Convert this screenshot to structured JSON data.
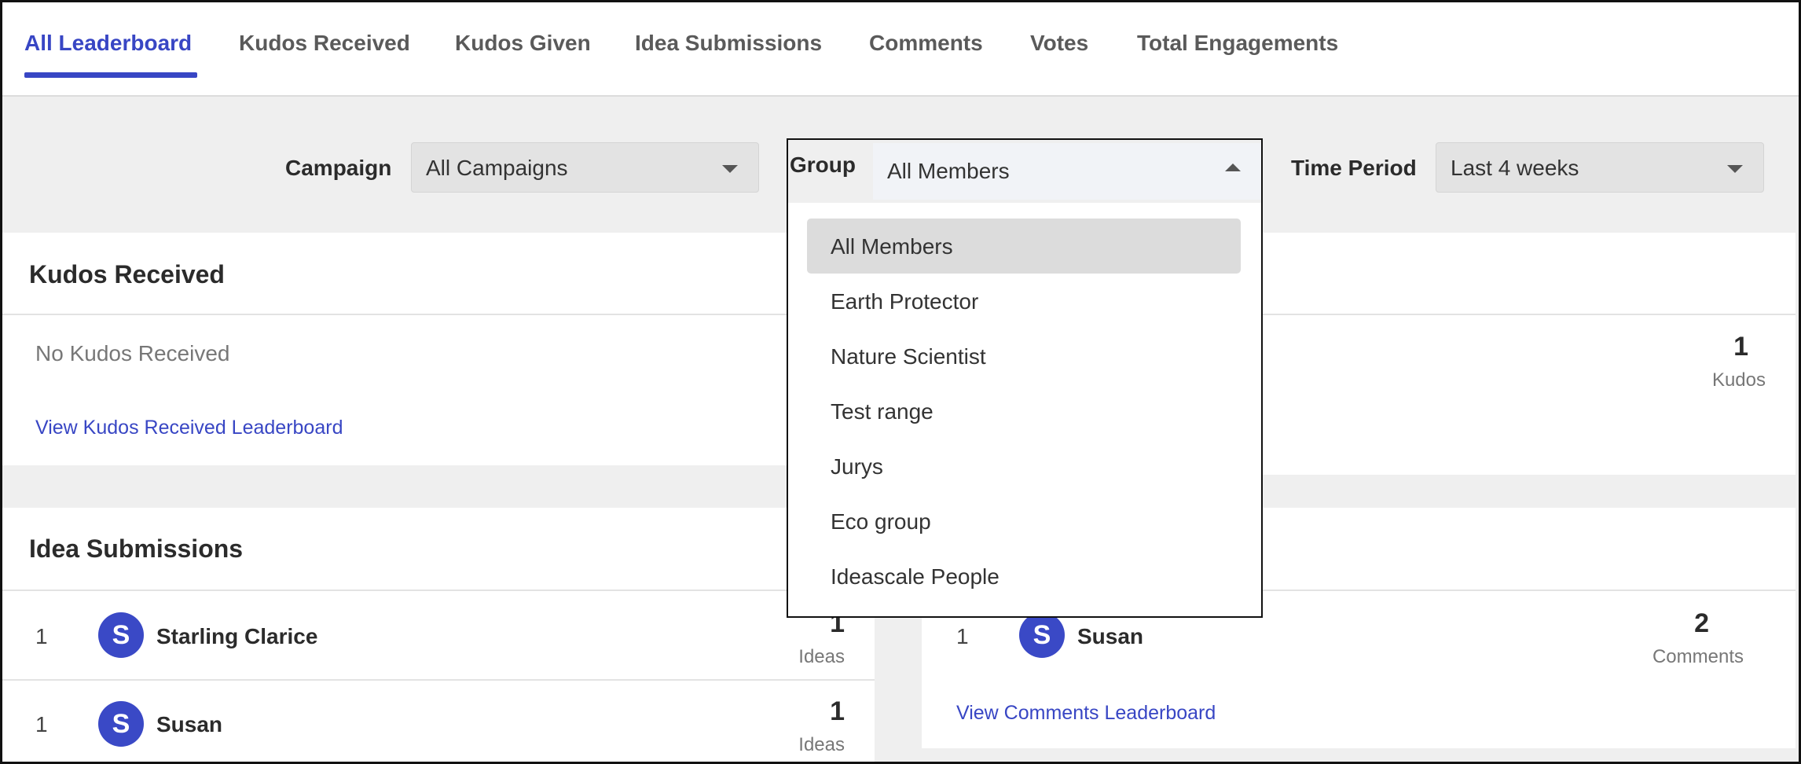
{
  "tabs": [
    {
      "label": "All Leaderboard",
      "active": true
    },
    {
      "label": "Kudos Received",
      "active": false
    },
    {
      "label": "Kudos Given",
      "active": false
    },
    {
      "label": "Idea Submissions",
      "active": false
    },
    {
      "label": "Comments",
      "active": false
    },
    {
      "label": "Votes",
      "active": false
    },
    {
      "label": "Total Engagements",
      "active": false
    }
  ],
  "filters": {
    "campaign": {
      "label": "Campaign",
      "value": "All Campaigns"
    },
    "group": {
      "label": "Group",
      "value": "All Members",
      "options": [
        "All Members",
        "Earth Protector",
        "Nature Scientist",
        "Test range",
        "Jurys",
        "Eco group",
        "Ideascale People"
      ],
      "selected": "All Members"
    },
    "time_period": {
      "label": "Time Period",
      "value": "Last 4 weeks"
    }
  },
  "kudos_received": {
    "title": "Kudos Received",
    "empty_text": "No Kudos Received",
    "link": "View Kudos Received Leaderboard"
  },
  "kudos_given": {
    "count": "1",
    "unit": "Kudos"
  },
  "idea_submissions": {
    "title": "Idea Submissions",
    "rows": [
      {
        "rank": "1",
        "initial": "S",
        "name": "Starling Clarice",
        "count": "1",
        "unit": "Ideas"
      },
      {
        "rank": "1",
        "initial": "S",
        "name": "Susan",
        "count": "1",
        "unit": "Ideas"
      }
    ]
  },
  "comments": {
    "rows": [
      {
        "rank": "1",
        "initial": "S",
        "name": "Susan",
        "count": "2",
        "unit": "Comments"
      }
    ],
    "link": "View Comments Leaderboard"
  },
  "colors": {
    "accent": "#3846c4",
    "avatar": "#3a49c6"
  }
}
